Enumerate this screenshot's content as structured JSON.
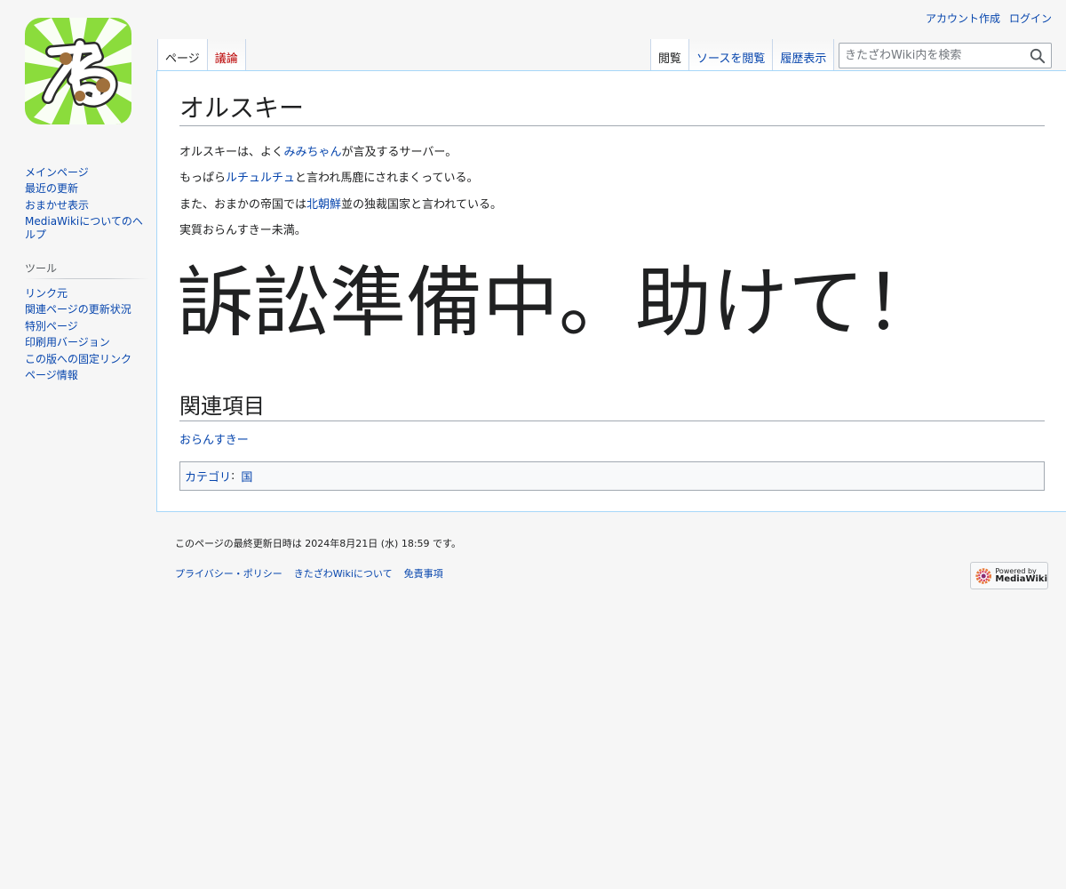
{
  "personal": {
    "create_account": "アカウント作成",
    "login": "ログイン"
  },
  "tabs": {
    "page": "ページ",
    "talk": "議論",
    "read": "閲覧",
    "view_source": "ソースを閲覧",
    "history": "履歴表示"
  },
  "search": {
    "placeholder": "きたざわWiki内を検索"
  },
  "sidebar": {
    "main": [
      "メインページ",
      "最近の更新",
      "おまかせ表示",
      "MediaWikiについてのヘルプ"
    ],
    "tools_heading": "ツール",
    "tools": [
      "リンク元",
      "関連ページの更新状況",
      "特別ページ",
      "印刷用バージョン",
      "この版への固定リンク",
      "ページ情報"
    ]
  },
  "article": {
    "title": "オルスキー",
    "p1": {
      "before": "オルスキーは、よく",
      "link": "みみちゃん",
      "after": "が言及するサーバー。"
    },
    "p2": {
      "before": "もっぱら",
      "link": "ルチュルチュ",
      "after": "と言われ馬鹿にされまくっている。"
    },
    "p3": {
      "before": "また、おまかの帝国では",
      "link": "北朝鮮",
      "after": "並の独裁国家と言われている。"
    },
    "p4": "実質おらんすきー未満。",
    "big": "訴訟準備中。助けて！",
    "related_heading": "関連項目",
    "related_link": "おらんすきー",
    "category_label": "カテゴリ",
    "category_colon": ":",
    "category_value": "国"
  },
  "footer": {
    "last_modified": "このページの最終更新日時は 2024年8月21日 (水) 18:59 です。",
    "privacy": "プライバシー・ポリシー",
    "about": "きたざわWikiについて",
    "disclaimer": "免責事項",
    "powered_small": "Powered by",
    "powered_big": "MediaWiki"
  },
  "colors": {
    "link": "#0645ad",
    "redlink": "#ba0000",
    "logo_bg": "#8bdc3c"
  }
}
